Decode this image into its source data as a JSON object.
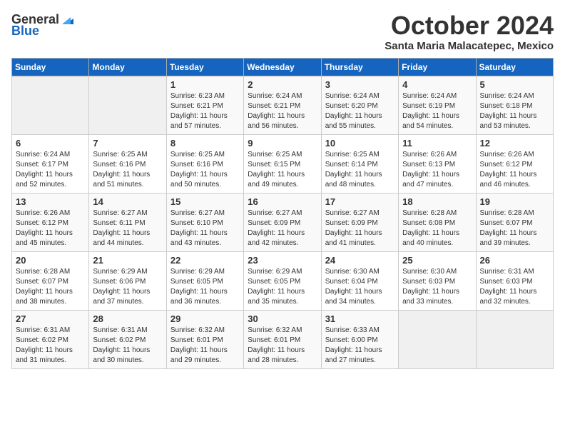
{
  "logo": {
    "general": "General",
    "blue": "Blue"
  },
  "title": {
    "month": "October 2024",
    "location": "Santa Maria Malacatepec, Mexico"
  },
  "weekdays": [
    "Sunday",
    "Monday",
    "Tuesday",
    "Wednesday",
    "Thursday",
    "Friday",
    "Saturday"
  ],
  "weeks": [
    [
      {
        "day": null
      },
      {
        "day": null
      },
      {
        "day": 1,
        "sunrise": "6:23 AM",
        "sunset": "6:21 PM",
        "daylight": "11 hours and 57 minutes."
      },
      {
        "day": 2,
        "sunrise": "6:24 AM",
        "sunset": "6:21 PM",
        "daylight": "11 hours and 56 minutes."
      },
      {
        "day": 3,
        "sunrise": "6:24 AM",
        "sunset": "6:20 PM",
        "daylight": "11 hours and 55 minutes."
      },
      {
        "day": 4,
        "sunrise": "6:24 AM",
        "sunset": "6:19 PM",
        "daylight": "11 hours and 54 minutes."
      },
      {
        "day": 5,
        "sunrise": "6:24 AM",
        "sunset": "6:18 PM",
        "daylight": "11 hours and 53 minutes."
      }
    ],
    [
      {
        "day": 6,
        "sunrise": "6:24 AM",
        "sunset": "6:17 PM",
        "daylight": "11 hours and 52 minutes."
      },
      {
        "day": 7,
        "sunrise": "6:25 AM",
        "sunset": "6:16 PM",
        "daylight": "11 hours and 51 minutes."
      },
      {
        "day": 8,
        "sunrise": "6:25 AM",
        "sunset": "6:16 PM",
        "daylight": "11 hours and 50 minutes."
      },
      {
        "day": 9,
        "sunrise": "6:25 AM",
        "sunset": "6:15 PM",
        "daylight": "11 hours and 49 minutes."
      },
      {
        "day": 10,
        "sunrise": "6:25 AM",
        "sunset": "6:14 PM",
        "daylight": "11 hours and 48 minutes."
      },
      {
        "day": 11,
        "sunrise": "6:26 AM",
        "sunset": "6:13 PM",
        "daylight": "11 hours and 47 minutes."
      },
      {
        "day": 12,
        "sunrise": "6:26 AM",
        "sunset": "6:12 PM",
        "daylight": "11 hours and 46 minutes."
      }
    ],
    [
      {
        "day": 13,
        "sunrise": "6:26 AM",
        "sunset": "6:12 PM",
        "daylight": "11 hours and 45 minutes."
      },
      {
        "day": 14,
        "sunrise": "6:27 AM",
        "sunset": "6:11 PM",
        "daylight": "11 hours and 44 minutes."
      },
      {
        "day": 15,
        "sunrise": "6:27 AM",
        "sunset": "6:10 PM",
        "daylight": "11 hours and 43 minutes."
      },
      {
        "day": 16,
        "sunrise": "6:27 AM",
        "sunset": "6:09 PM",
        "daylight": "11 hours and 42 minutes."
      },
      {
        "day": 17,
        "sunrise": "6:27 AM",
        "sunset": "6:09 PM",
        "daylight": "11 hours and 41 minutes."
      },
      {
        "day": 18,
        "sunrise": "6:28 AM",
        "sunset": "6:08 PM",
        "daylight": "11 hours and 40 minutes."
      },
      {
        "day": 19,
        "sunrise": "6:28 AM",
        "sunset": "6:07 PM",
        "daylight": "11 hours and 39 minutes."
      }
    ],
    [
      {
        "day": 20,
        "sunrise": "6:28 AM",
        "sunset": "6:07 PM",
        "daylight": "11 hours and 38 minutes."
      },
      {
        "day": 21,
        "sunrise": "6:29 AM",
        "sunset": "6:06 PM",
        "daylight": "11 hours and 37 minutes."
      },
      {
        "day": 22,
        "sunrise": "6:29 AM",
        "sunset": "6:05 PM",
        "daylight": "11 hours and 36 minutes."
      },
      {
        "day": 23,
        "sunrise": "6:29 AM",
        "sunset": "6:05 PM",
        "daylight": "11 hours and 35 minutes."
      },
      {
        "day": 24,
        "sunrise": "6:30 AM",
        "sunset": "6:04 PM",
        "daylight": "11 hours and 34 minutes."
      },
      {
        "day": 25,
        "sunrise": "6:30 AM",
        "sunset": "6:03 PM",
        "daylight": "11 hours and 33 minutes."
      },
      {
        "day": 26,
        "sunrise": "6:31 AM",
        "sunset": "6:03 PM",
        "daylight": "11 hours and 32 minutes."
      }
    ],
    [
      {
        "day": 27,
        "sunrise": "6:31 AM",
        "sunset": "6:02 PM",
        "daylight": "11 hours and 31 minutes."
      },
      {
        "day": 28,
        "sunrise": "6:31 AM",
        "sunset": "6:02 PM",
        "daylight": "11 hours and 30 minutes."
      },
      {
        "day": 29,
        "sunrise": "6:32 AM",
        "sunset": "6:01 PM",
        "daylight": "11 hours and 29 minutes."
      },
      {
        "day": 30,
        "sunrise": "6:32 AM",
        "sunset": "6:01 PM",
        "daylight": "11 hours and 28 minutes."
      },
      {
        "day": 31,
        "sunrise": "6:33 AM",
        "sunset": "6:00 PM",
        "daylight": "11 hours and 27 minutes."
      },
      {
        "day": null
      },
      {
        "day": null
      }
    ]
  ],
  "labels": {
    "sunrise": "Sunrise:",
    "sunset": "Sunset:",
    "daylight": "Daylight:"
  }
}
